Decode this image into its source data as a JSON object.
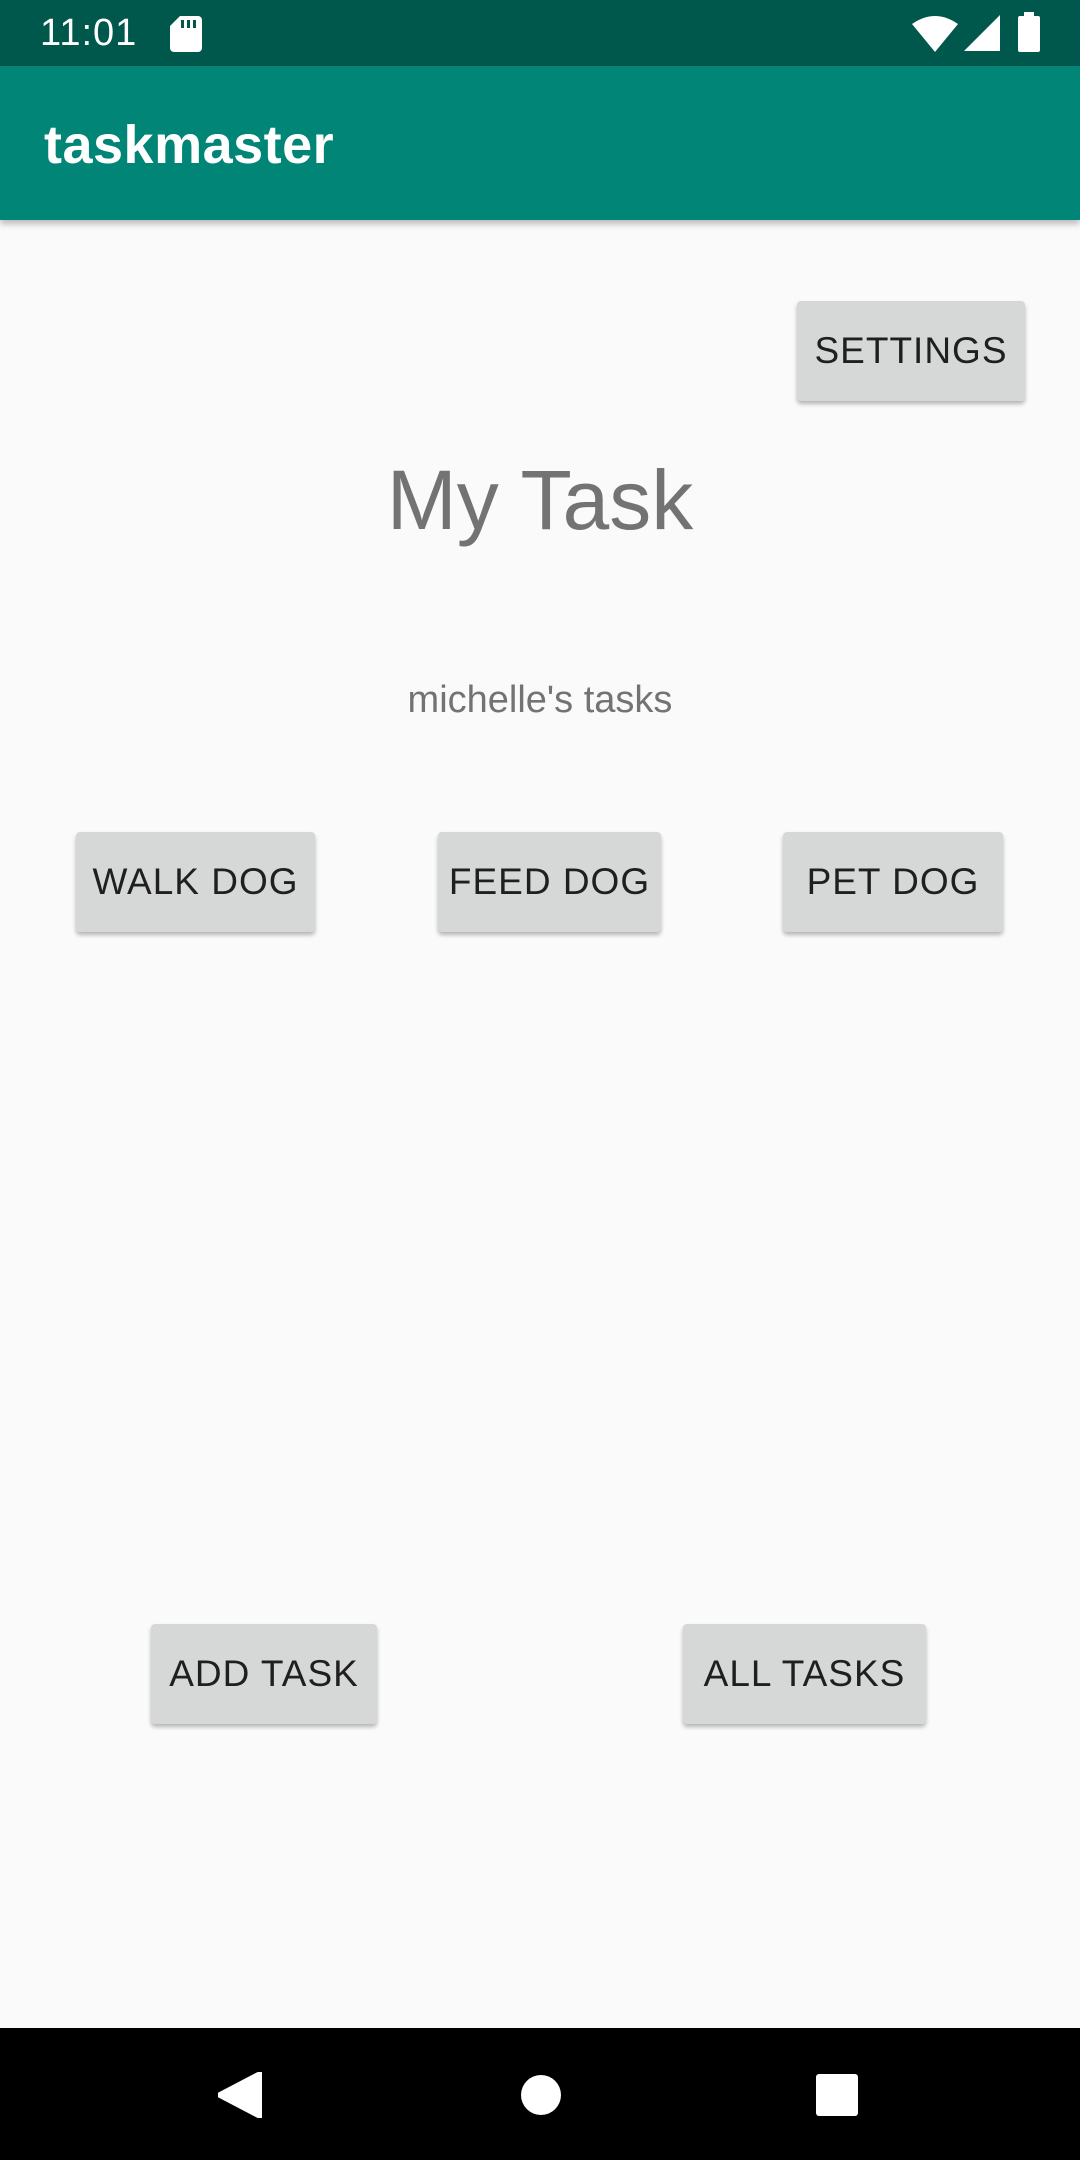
{
  "status_bar": {
    "time": "11:01",
    "icons": [
      "sd-card-icon",
      "wifi-icon",
      "cell-signal-icon",
      "battery-icon"
    ]
  },
  "app_bar": {
    "title": "taskmaster"
  },
  "main": {
    "settings_label": "SETTINGS",
    "title": "My Task",
    "subtitle": "michelle's tasks",
    "task_buttons": [
      "WALK DOG",
      "FEED DOG",
      "PET DOG"
    ],
    "add_task_label": "ADD TASK",
    "all_tasks_label": "ALL TASKS"
  },
  "nav_bar": {
    "icons": [
      "back-icon",
      "home-icon",
      "recents-icon"
    ]
  },
  "colors": {
    "status_bar": "#00574b",
    "app_bar": "#008577",
    "background": "#fafafa",
    "button": "#d6d7d7",
    "title_text": "#737373"
  }
}
